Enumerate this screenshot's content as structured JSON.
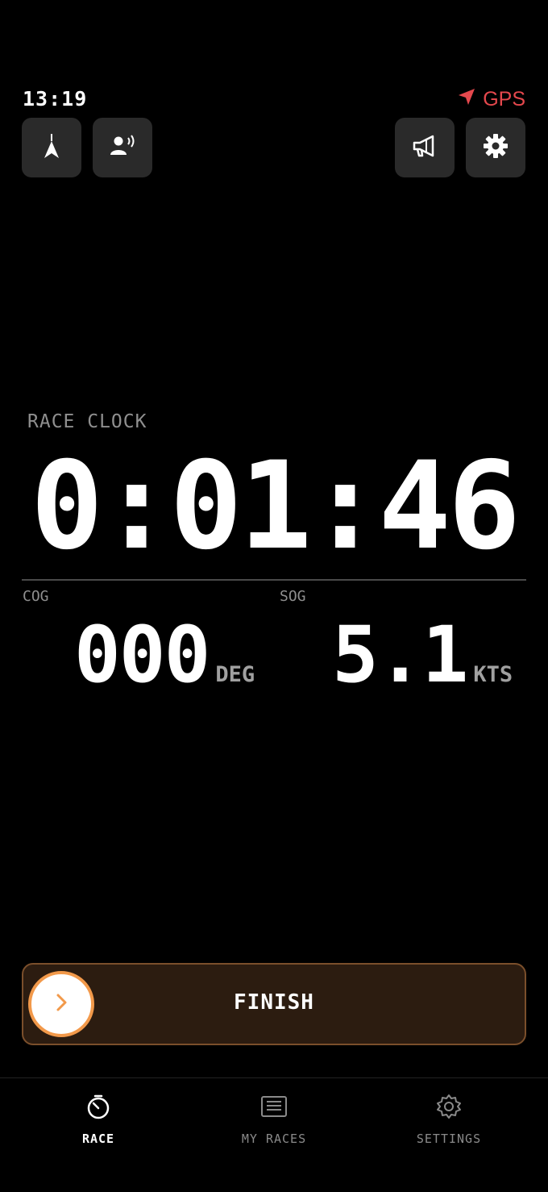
{
  "status": {
    "time": "13:19",
    "gps_label": "GPS",
    "gps_color": "#e5484d"
  },
  "toolbar": {
    "left_icons": [
      "north-arrow-icon",
      "voice-icon"
    ],
    "right_icons": [
      "megaphone-icon",
      "gear-icon"
    ]
  },
  "race": {
    "clock_label": "RACE CLOCK",
    "clock_value": "0:01:46",
    "cog_label": "COG",
    "cog_value": "000",
    "cog_unit": "DEG",
    "sog_label": "SOG",
    "sog_value": "5.1",
    "sog_unit": "KTS"
  },
  "finish": {
    "label": "FINISH",
    "accent": "#f2994a"
  },
  "tabs": [
    {
      "label": "RACE",
      "icon": "stopwatch-icon",
      "active": true
    },
    {
      "label": "MY RACES",
      "icon": "list-icon",
      "active": false
    },
    {
      "label": "SETTINGS",
      "icon": "gear-icon",
      "active": false
    }
  ]
}
